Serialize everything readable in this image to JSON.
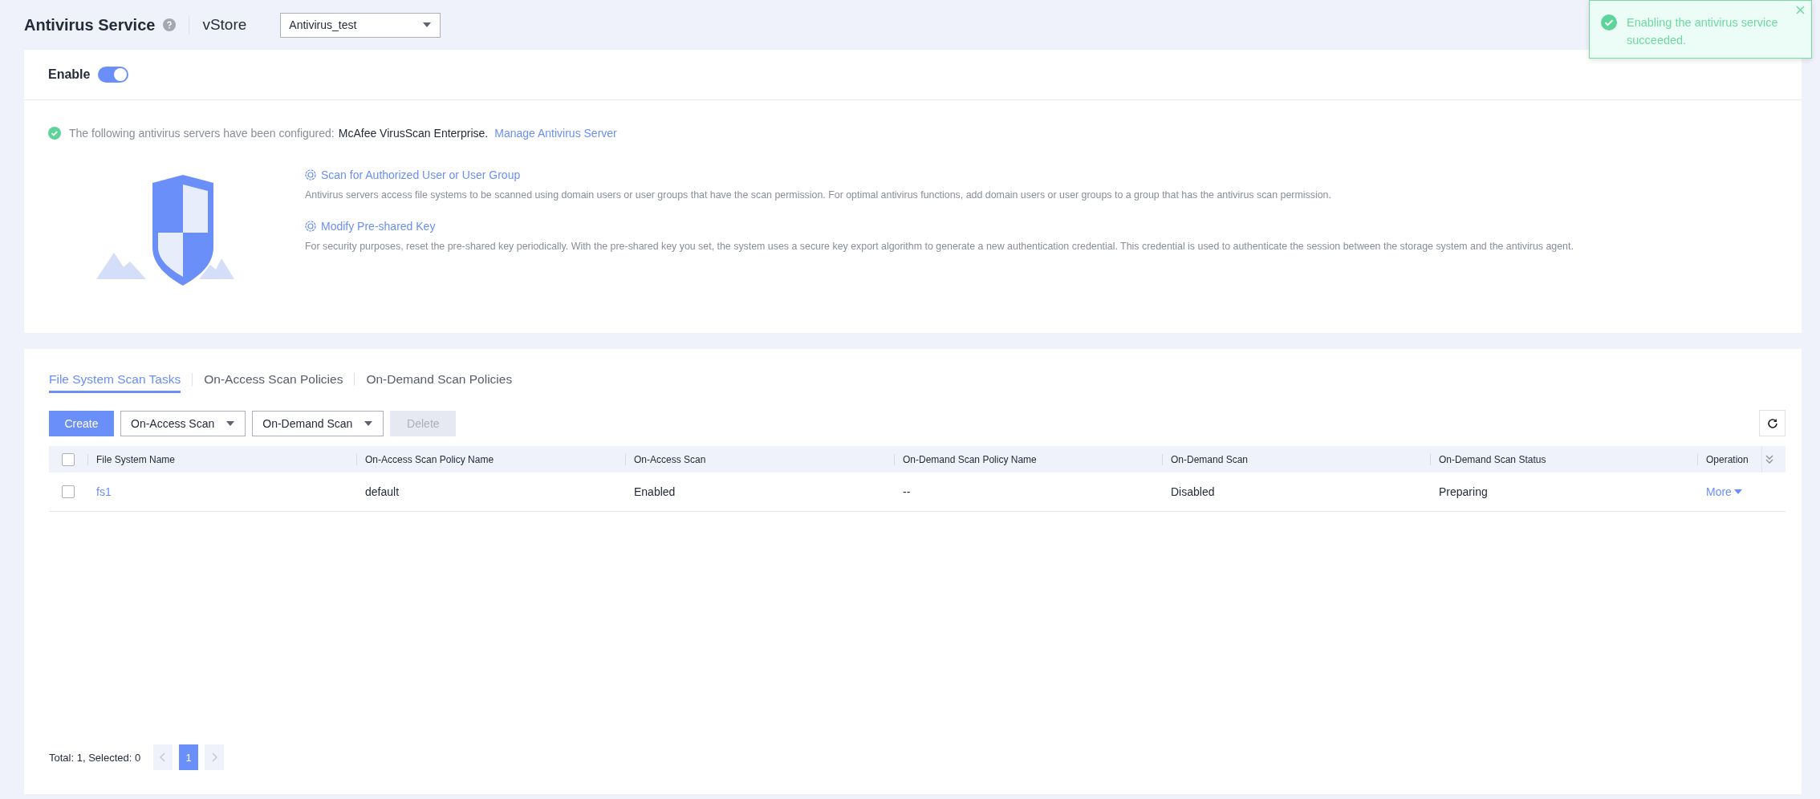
{
  "header": {
    "title": "Antivirus Service",
    "vstore_label": "vStore",
    "vstore_select": "Antivirus_test"
  },
  "enable": {
    "label": "Enable",
    "on": true
  },
  "notice": {
    "text": "The following antivirus servers have been configured:",
    "server": "McAfee VirusScan Enterprise.",
    "link": "Manage Antivirus Server"
  },
  "features": [
    {
      "title": "Scan for Authorized User or User Group",
      "description": "Antivirus servers access file systems to be scanned using domain users or user groups that have the scan permission. For optimal antivirus functions, add domain users or user groups to a group that has the antivirus scan permission."
    },
    {
      "title": "Modify Pre-shared Key",
      "description": "For security purposes, reset the pre-shared key periodically. With the pre-shared key you set, the system uses a secure key export algorithm to generate a new authentication credential. This credential is used to authenticate the session between the storage system and the antivirus agent."
    }
  ],
  "tabs": [
    {
      "label": "File System Scan Tasks",
      "selected": true
    },
    {
      "label": "On-Access Scan Policies",
      "selected": false
    },
    {
      "label": "On-Demand Scan Policies",
      "selected": false
    }
  ],
  "toolbar": [
    {
      "label": "Create",
      "kind": "primary",
      "disabled": false
    },
    {
      "label": "On-Access Scan",
      "kind": "dropdown",
      "disabled": false
    },
    {
      "label": "On-Demand Scan",
      "kind": "dropdown",
      "disabled": false
    },
    {
      "label": "Delete",
      "kind": "plain",
      "disabled": true
    }
  ],
  "table": {
    "select_all": false,
    "columns": [
      "File System Name",
      "On-Access Scan Policy Name",
      "On-Access Scan",
      "On-Demand Scan Policy Name",
      "On-Demand Scan",
      "On-Demand Scan Status",
      "Operation"
    ],
    "rows": [
      {
        "selected": false,
        "cells": [
          "fs1",
          "default",
          "Enabled",
          "--",
          "Disabled",
          "Preparing",
          "More"
        ]
      }
    ]
  },
  "pagination": {
    "summary": "Total: 1, Selected: 0",
    "pages": [
      {
        "label": "1",
        "selected": true
      }
    ]
  },
  "toast": {
    "message": "Enabling the antivirus service succeeded."
  }
}
